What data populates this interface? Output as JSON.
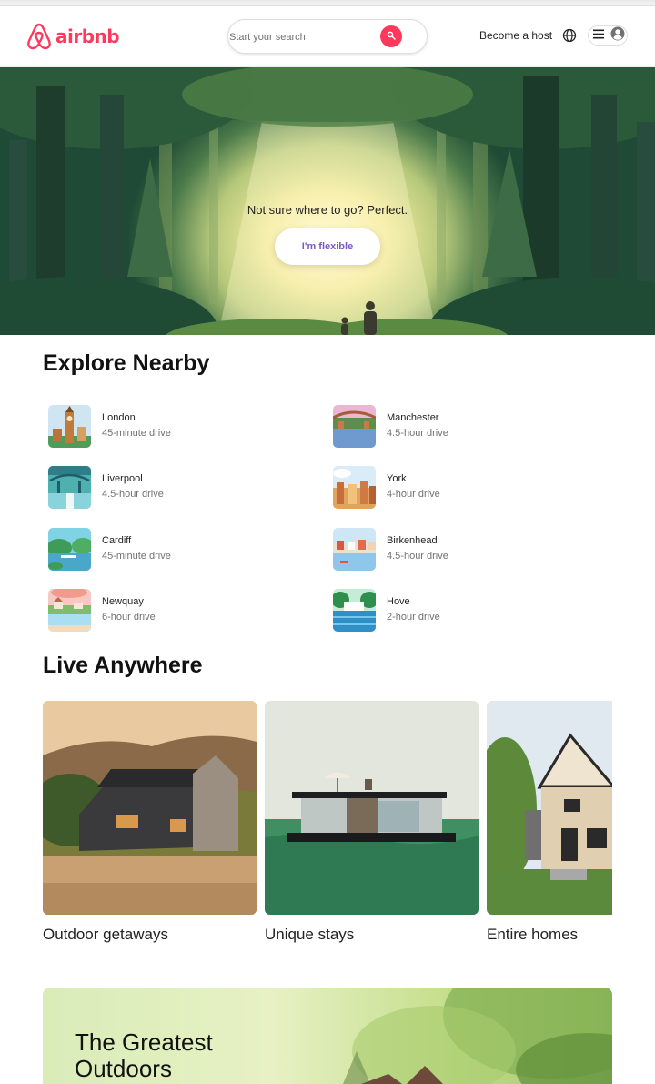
{
  "header": {
    "logo_text": "airbnb",
    "search_placeholder": "Start your search",
    "host_link": "Become a host",
    "icons": [
      "airbnb-logo-icon",
      "search-icon",
      "globe-icon",
      "hamburger-menu-icon",
      "user-avatar-icon"
    ],
    "brand_color": "#ff385c"
  },
  "hero": {
    "tagline": "Not sure where to go? Perfect.",
    "button_label": "I'm flexible",
    "button_color": "#7f56c8"
  },
  "explore": {
    "title": "Explore Nearby",
    "items": [
      {
        "city": "London",
        "distance": "45-minute drive"
      },
      {
        "city": "Manchester",
        "distance": "4.5-hour drive"
      },
      {
        "city": "Liverpool",
        "distance": "4.5-hour drive"
      },
      {
        "city": "York",
        "distance": "4-hour drive"
      },
      {
        "city": "Cardiff",
        "distance": "45-minute drive"
      },
      {
        "city": "Birkenhead",
        "distance": "4.5-hour drive"
      },
      {
        "city": "Newquay",
        "distance": "6-hour drive"
      },
      {
        "city": "Hove",
        "distance": "2-hour drive"
      }
    ]
  },
  "live": {
    "title": "Live Anywhere",
    "cards": [
      {
        "label": "Outdoor getaways"
      },
      {
        "label": "Unique stays"
      },
      {
        "label": "Entire homes"
      }
    ]
  },
  "outdoors": {
    "title": "The Greatest Outdoors"
  }
}
